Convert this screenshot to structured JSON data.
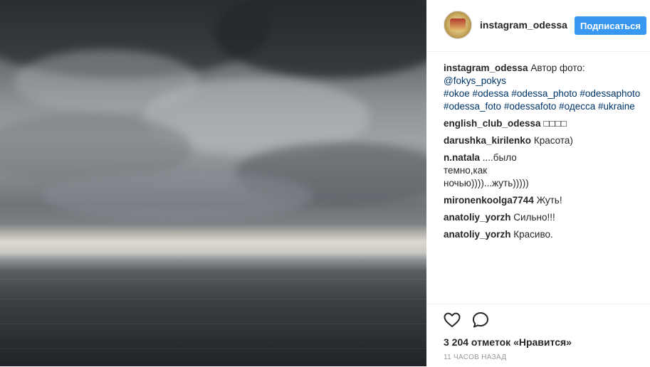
{
  "post": {
    "username": "instagram_odessa",
    "follow_label": "Подписаться",
    "caption": {
      "user": "instagram_odessa",
      "text": "Автор фото: ",
      "mention": "@fokys_pokys",
      "tags_line1": "#okoe #odessa #odessa_photo #odessaphoto",
      "tags_line2": "#odessa_foto #odessafoto #одесса #ukraine"
    },
    "comments": [
      {
        "user": "english_club_odessa",
        "text": "□□□□"
      },
      {
        "user": "darushka_kirilenko",
        "text": "Красота)"
      },
      {
        "user": "n.natala",
        "text": "....было темно,как ночью))))...жуть)))))"
      },
      {
        "user": "mironenkoolga7744",
        "text": "Жуть!"
      },
      {
        "user": "anatoliy_yorzh",
        "text": "Сильно!!!"
      },
      {
        "user": "anatoliy_yorzh",
        "text": "Красиво."
      }
    ],
    "likes_count": "3 204",
    "likes_suffix": " отметок «Нравится»",
    "time": "11 ЧАСОВ НАЗАД"
  },
  "icons": {
    "like": "heart-icon",
    "comment": "comment-bubble-icon"
  },
  "colors": {
    "follow_button": "#3897f0",
    "link": "#003569",
    "time": "#999999"
  }
}
